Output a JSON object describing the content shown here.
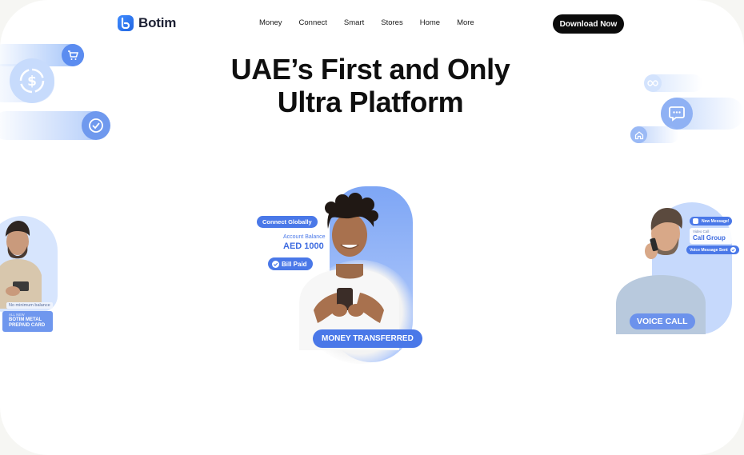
{
  "header": {
    "brand": "Botim",
    "nav": [
      "Money",
      "Connect",
      "Smart",
      "Stores",
      "Home",
      "More"
    ],
    "cta": "Download Now"
  },
  "hero": {
    "line1": "UAE’s First and Only",
    "line2": "Ultra Platform"
  },
  "center_card": {
    "pill_connect": "Connect Globally",
    "balance_label": "Account Balance",
    "balance_value": "AED 1000",
    "bill_paid": "Bill Paid",
    "banner": "MONEY TRANSFERRED"
  },
  "left_card": {
    "note": "No minimum balance",
    "card_small": "ALL NEW",
    "card_title_1": "BOTIM METAL",
    "card_title_2": "PREPAID CARD"
  },
  "right_card": {
    "new_message": "New Message!",
    "call_label": "Video Call",
    "call_group": "Call Group",
    "voice_msg": "Voice Message Sent",
    "banner": "VOICE CALL"
  },
  "colors": {
    "brand_blue": "#3b74e6",
    "pill_blue": "#4a78e8",
    "dark": "#0b0b0b"
  }
}
